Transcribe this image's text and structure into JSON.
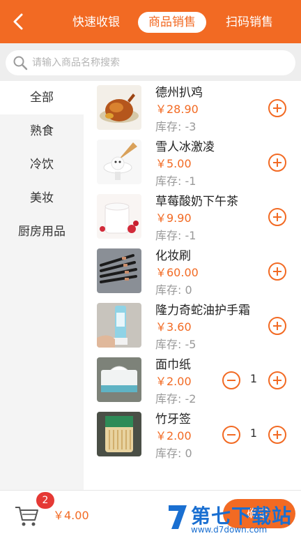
{
  "header": {
    "tabs": [
      {
        "label": "快速收银",
        "active": false
      },
      {
        "label": "商品销售",
        "active": true
      },
      {
        "label": "扫码销售",
        "active": false
      }
    ],
    "accent_color": "#f26a23"
  },
  "search": {
    "placeholder": "请输入商品名称搜索",
    "value": ""
  },
  "categories": [
    {
      "label": "全部",
      "active": true
    },
    {
      "label": "熟食",
      "active": false
    },
    {
      "label": "冷饮",
      "active": false
    },
    {
      "label": "美妆",
      "active": false
    },
    {
      "label": "厨房用品",
      "active": false
    }
  ],
  "products": [
    {
      "name": "德州扒鸡",
      "price": "￥28.90",
      "stock": "库存: -3",
      "qty": null
    },
    {
      "name": "雪人冰激凌",
      "price": "￥5.00",
      "stock": "库存: -1",
      "qty": null
    },
    {
      "name": "草莓酸奶下午茶",
      "price": "￥9.90",
      "stock": "库存: -1",
      "qty": null
    },
    {
      "name": "化妆刷",
      "price": "￥60.00",
      "stock": "库存: 0",
      "qty": null
    },
    {
      "name": "隆力奇蛇油护手霜",
      "price": "￥3.60",
      "stock": "库存: -5",
      "qty": null
    },
    {
      "name": "面巾纸",
      "price": "￥2.00",
      "stock": "库存: -2",
      "qty": "1"
    },
    {
      "name": "竹牙签",
      "price": "￥2.00",
      "stock": "库存: 0",
      "qty": "1"
    }
  ],
  "footer": {
    "cart_count": "2",
    "total": "￥4.00",
    "confirm_label": "确定"
  },
  "watermark": {
    "brand": "第七下载站",
    "url": "www.d7down.com"
  }
}
